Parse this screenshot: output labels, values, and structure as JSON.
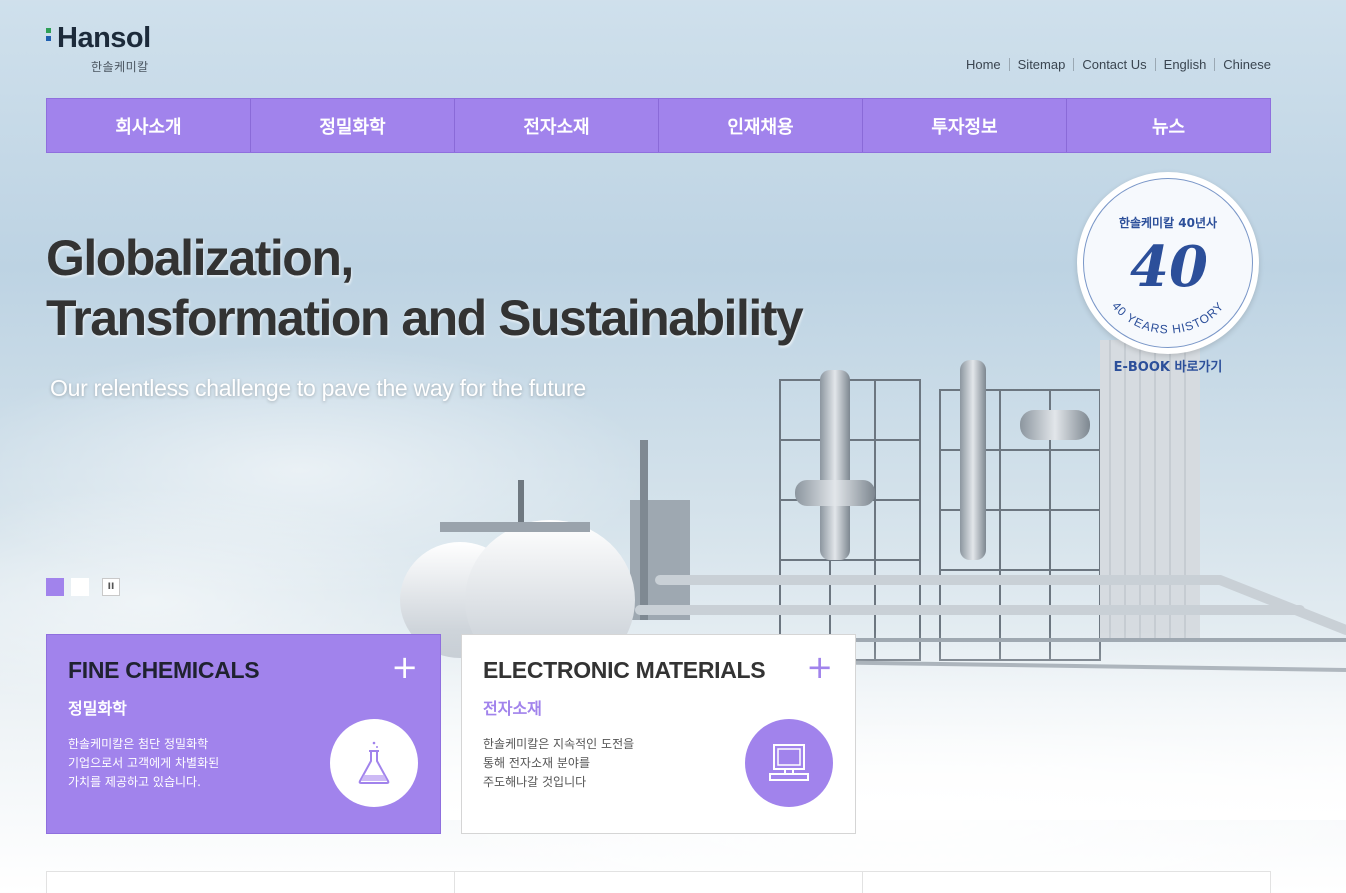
{
  "logo": {
    "name": "Hansol",
    "sub": "한솔케미칼",
    "mark_colors": [
      "#2e9f57",
      "#1e5fb0"
    ]
  },
  "util_nav": [
    "Home",
    "Sitemap",
    "Contact Us",
    "English",
    "Chinese"
  ],
  "gnb": [
    "회사소개",
    "정밀화학",
    "전자소재",
    "인재채용",
    "투자정보",
    "뉴스"
  ],
  "hero": {
    "title_line1": "Globalization,",
    "title_line2": "Transformation and Sustainability",
    "subtitle": "Our relentless challenge to pave the way for the future"
  },
  "badge": {
    "top": "한솔케미칼 40년사",
    "number": "40",
    "arc": "40 YEARS HISTORY",
    "ebook": "E-BOOK 바로가기"
  },
  "slider": {
    "pause_icon": "pause-icon",
    "pause_glyph": "II"
  },
  "cards": {
    "fine": {
      "title": "FINE CHEMICALS",
      "plus": "+",
      "ko": "정밀화학",
      "desc": [
        "한솔케미칼은 첨단 정밀화학",
        "기업으로서 고객에게 차별화된",
        "가치를 제공하고 있습니다."
      ],
      "icon": "flask-icon"
    },
    "elec": {
      "title": "ELECTRONIC MATERIALS",
      "plus": "+",
      "ko": "전자소재",
      "desc": [
        "한솔케미칼은 지속적인 도전을",
        "통해 전자소재 분야를",
        "주도해나갈 것입니다"
      ],
      "icon": "computer-icon"
    }
  },
  "colors": {
    "accent": "#a183ec",
    "badge_blue": "#2c4f9a"
  }
}
